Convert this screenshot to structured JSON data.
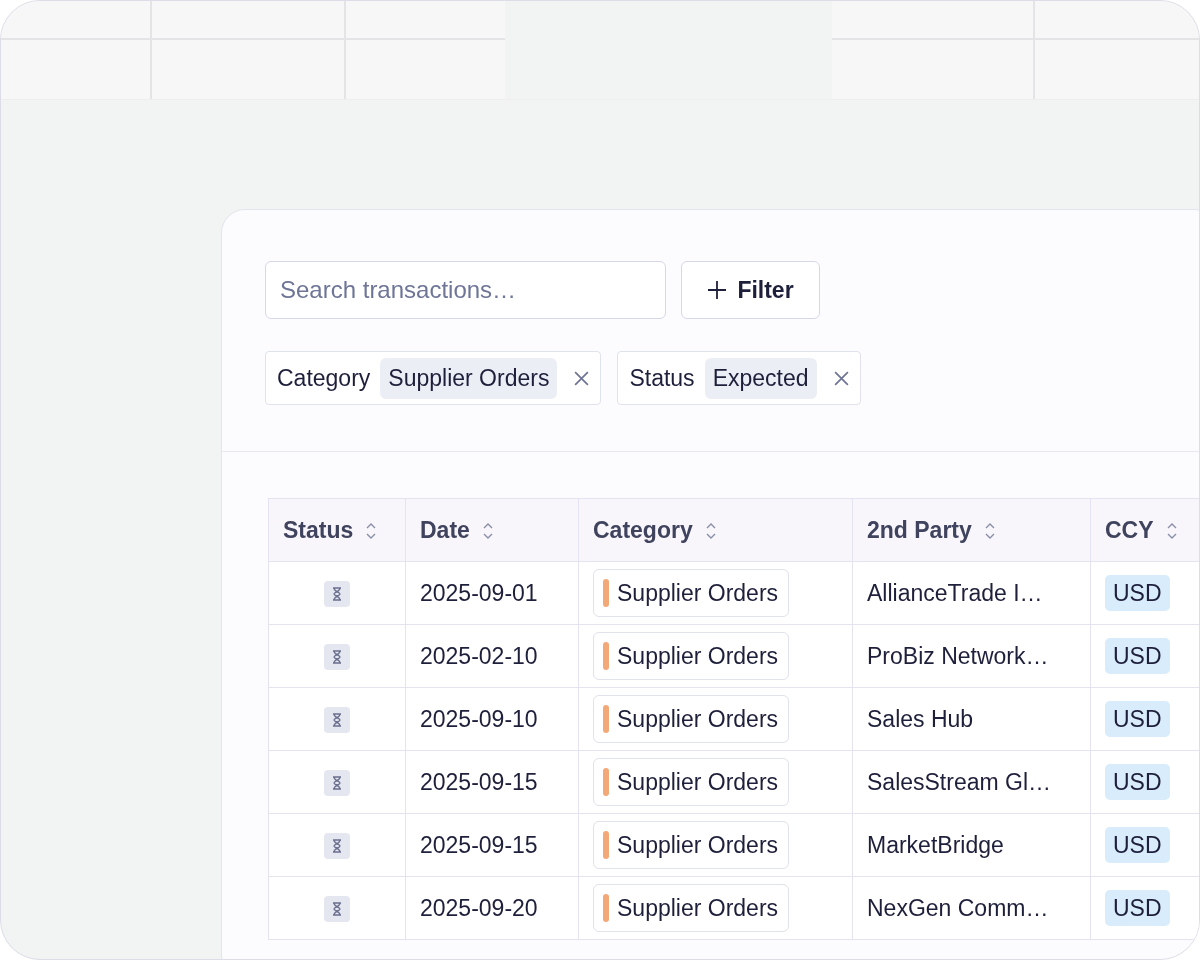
{
  "search": {
    "placeholder": "Search transactions…"
  },
  "filter_button": {
    "label": "Filter"
  },
  "active_filters": [
    {
      "field": "Category",
      "value": "Supplier Orders"
    },
    {
      "field": "Status",
      "value": "Expected"
    }
  ],
  "table": {
    "columns": [
      {
        "label": "Status"
      },
      {
        "label": "Date"
      },
      {
        "label": "Category"
      },
      {
        "label": "2nd Party"
      },
      {
        "label": "CCY"
      }
    ],
    "rows": [
      {
        "pending": true,
        "date": "2025-09-01",
        "category": {
          "label": "Supplier Orders",
          "color": "#f2a877"
        },
        "party": "AllianceTrade I…",
        "ccy": "USD"
      },
      {
        "pending": true,
        "date": "2025-02-10",
        "category": {
          "label": "Supplier Orders",
          "color": "#f2a877"
        },
        "party": "ProBiz Network…",
        "ccy": "USD"
      },
      {
        "pending": true,
        "date": "2025-09-10",
        "category": {
          "label": "Supplier Orders",
          "color": "#f2a877"
        },
        "party": "Sales Hub",
        "ccy": "USD"
      },
      {
        "pending": true,
        "date": "2025-09-15",
        "category": {
          "label": "Supplier Orders",
          "color": "#f2a877"
        },
        "party": "SalesStream Gl…",
        "ccy": "USD"
      },
      {
        "pending": true,
        "date": "2025-09-15",
        "category": {
          "label": "Supplier Orders",
          "color": "#f2a877"
        },
        "party": "MarketBridge",
        "ccy": "USD"
      },
      {
        "pending": true,
        "date": "2025-09-20",
        "category": {
          "label": "Supplier Orders",
          "color": "#f2a877"
        },
        "party": "NexGen Comm…",
        "ccy": "USD"
      }
    ]
  }
}
